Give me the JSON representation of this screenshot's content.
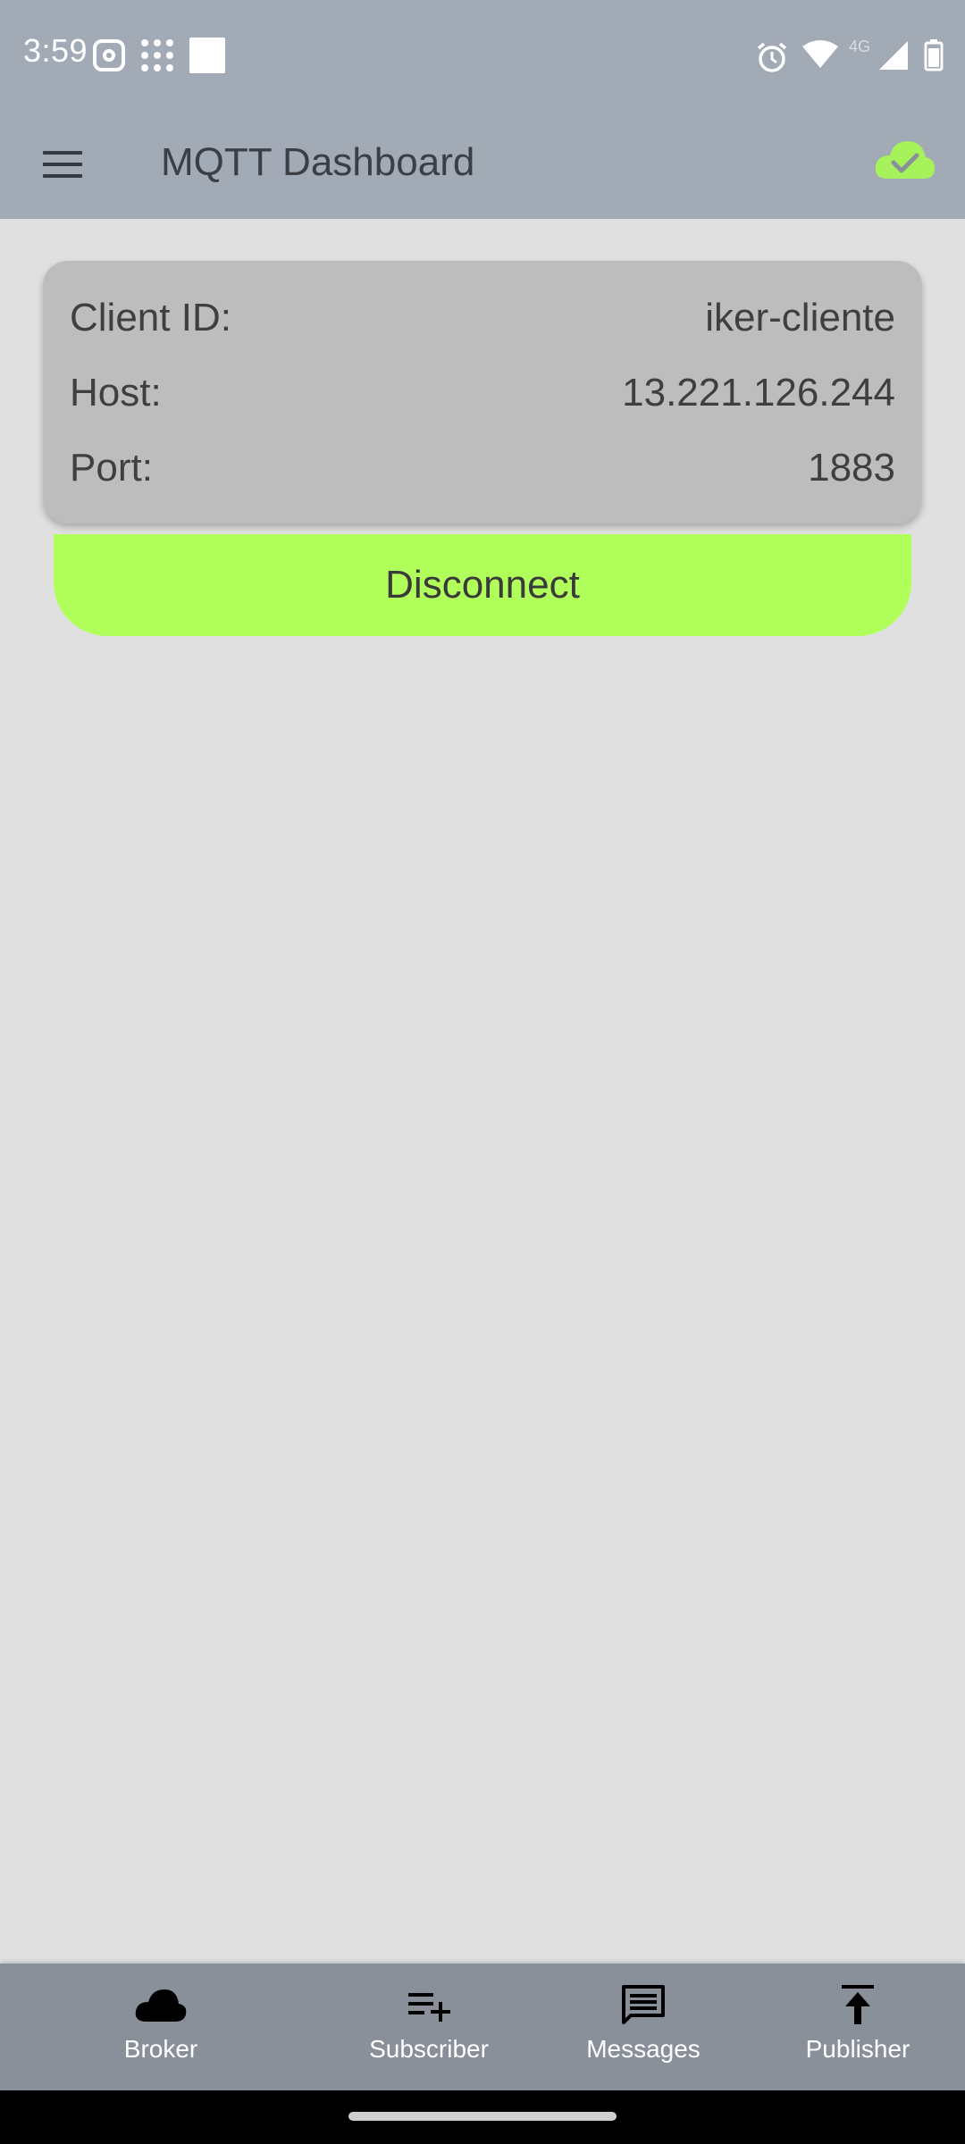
{
  "status_bar": {
    "time": "3:59",
    "network_label": "4G",
    "icons": [
      "instagram-icon",
      "apps-dots-icon",
      "notification-square-icon",
      "alarm-icon",
      "wifi-icon",
      "signal-icon",
      "battery-icon"
    ]
  },
  "app_bar": {
    "title": "MQTT Dashboard",
    "menu_icon": "hamburger-menu-icon",
    "status_icon": "cloud-check-icon",
    "status_color": "#a6f25a"
  },
  "connection": {
    "client_id_label": "Client ID:",
    "client_id_value": "iker-cliente",
    "host_label": "Host:",
    "host_value": "13.221.126.244",
    "port_label": "Port:",
    "port_value": "1883"
  },
  "actions": {
    "disconnect_label": "Disconnect",
    "disconnect_color": "#b0ff5a"
  },
  "bottom_nav": {
    "items": [
      {
        "label": "Broker",
        "icon": "cloud-icon"
      },
      {
        "label": "Subscriber",
        "icon": "playlist-add-icon"
      },
      {
        "label": "Messages",
        "icon": "message-icon"
      },
      {
        "label": "Publisher",
        "icon": "publish-icon"
      }
    ]
  }
}
